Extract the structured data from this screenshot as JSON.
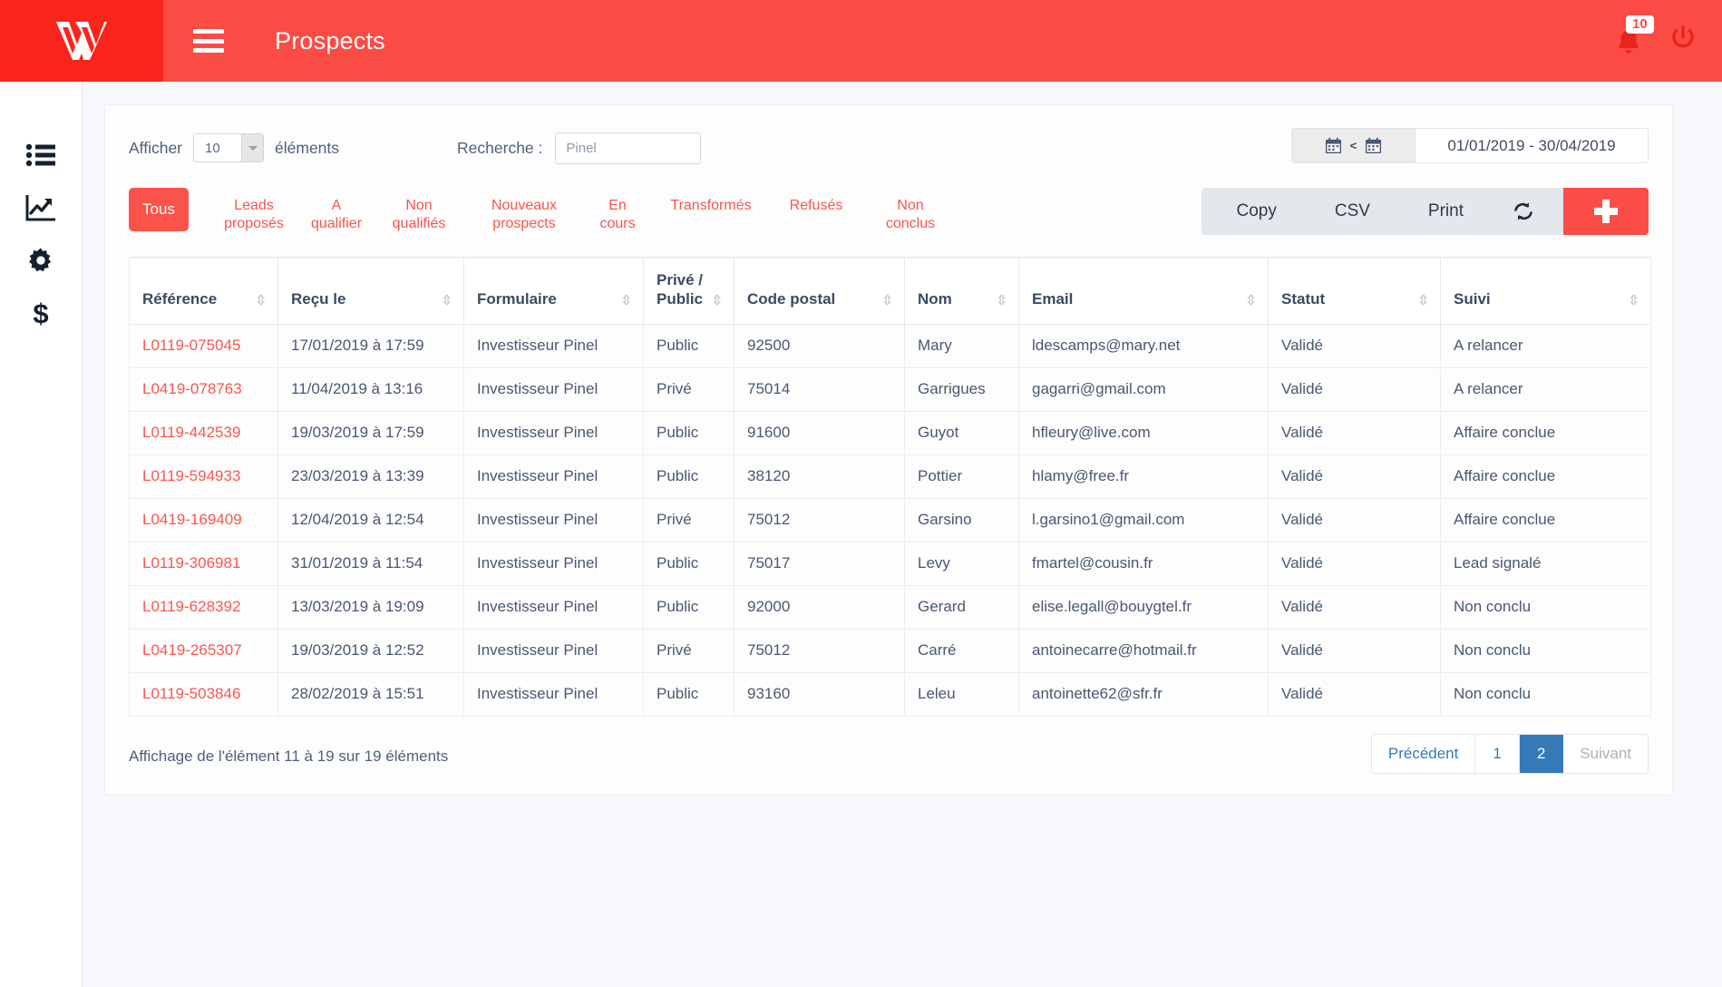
{
  "header": {
    "title": "Prospects",
    "logo_icon": "vwg-logo-icon",
    "menu_icon": "hamburger-menu-icon",
    "notification_icon": "bell-icon",
    "notification_count": "10",
    "power_icon": "power-icon"
  },
  "sidebar": {
    "items": [
      {
        "icon": "list-icon",
        "name": "sidebar-item-list"
      },
      {
        "icon": "chart-line-icon",
        "name": "sidebar-item-statistics"
      },
      {
        "icon": "gear-icon",
        "name": "sidebar-item-settings"
      },
      {
        "icon": "dollar-icon",
        "name": "sidebar-item-billing"
      }
    ]
  },
  "toolbar": {
    "show_label": "Afficher",
    "length_value": "10",
    "elements_label": "éléments",
    "search_label": "Recherche :",
    "search_value": "Pinel",
    "search_placeholder": "Pinel",
    "date_range": "01/01/2019 - 30/04/2019",
    "calendar_icon": "calendar-icon",
    "range_separator": "<"
  },
  "tabs": [
    {
      "label": "Tous",
      "active": true
    },
    {
      "label": "Leads\nproposés",
      "active": false
    },
    {
      "label": "A\nqualifier",
      "active": false
    },
    {
      "label": "Non\nqualifiés",
      "active": false
    },
    {
      "label": "Nouveaux\nprospects",
      "active": false
    },
    {
      "label": "En\ncours",
      "active": false
    },
    {
      "label": "Transformés",
      "active": false
    },
    {
      "label": "Refusés",
      "active": false
    },
    {
      "label": "Non\nconclus",
      "active": false
    }
  ],
  "export": {
    "copy_label": "Copy",
    "csv_label": "CSV",
    "print_label": "Print",
    "refresh_icon": "refresh-icon",
    "add_icon": "plus-icon"
  },
  "table": {
    "columns": [
      "Référence",
      "Reçu le",
      "Formulaire",
      "Privé /\nPublic",
      "Code postal",
      "Nom",
      "Email",
      "Statut",
      "Suivi"
    ],
    "sort_icon": "sort-arrows-icon",
    "rows": [
      {
        "reference": "L0119-075045",
        "received": "17/01/2019 à 17:59",
        "form": "Investisseur Pinel",
        "visibility": "Public",
        "postal_code": "92500",
        "name": "Mary",
        "email": "ldescamps@mary.net",
        "status": "Validé",
        "followup": "A relancer"
      },
      {
        "reference": "L0419-078763",
        "received": "11/04/2019 à 13:16",
        "form": "Investisseur Pinel",
        "visibility": "Privé",
        "postal_code": "75014",
        "name": "Garrigues",
        "email": "gagarri@gmail.com",
        "status": "Validé",
        "followup": "A relancer"
      },
      {
        "reference": "L0119-442539",
        "received": "19/03/2019 à 17:59",
        "form": "Investisseur Pinel",
        "visibility": "Public",
        "postal_code": "91600",
        "name": "Guyot",
        "email": "hfleury@live.com",
        "status": "Validé",
        "followup": "Affaire conclue"
      },
      {
        "reference": "L0119-594933",
        "received": "23/03/2019 à 13:39",
        "form": "Investisseur Pinel",
        "visibility": "Public",
        "postal_code": "38120",
        "name": "Pottier",
        "email": "hlamy@free.fr",
        "status": "Validé",
        "followup": "Affaire conclue"
      },
      {
        "reference": "L0419-169409",
        "received": "12/04/2019 à 12:54",
        "form": "Investisseur Pinel",
        "visibility": "Privé",
        "postal_code": "75012",
        "name": "Garsino",
        "email": "l.garsino1@gmail.com",
        "status": "Validé",
        "followup": "Affaire conclue"
      },
      {
        "reference": "L0119-306981",
        "received": "31/01/2019 à 11:54",
        "form": "Investisseur Pinel",
        "visibility": "Public",
        "postal_code": "75017",
        "name": "Levy",
        "email": "fmartel@cousin.fr",
        "status": "Validé",
        "followup": "Lead signalé"
      },
      {
        "reference": "L0119-628392",
        "received": "13/03/2019 à 19:09",
        "form": "Investisseur Pinel",
        "visibility": "Public",
        "postal_code": "92000",
        "name": "Gerard",
        "email": "elise.legall@bouygtel.fr",
        "status": "Validé",
        "followup": "Non conclu"
      },
      {
        "reference": "L0419-265307",
        "received": "19/03/2019 à 12:52",
        "form": "Investisseur Pinel",
        "visibility": "Privé",
        "postal_code": "75012",
        "name": "Carré",
        "email": "antoinecarre@hotmail.fr",
        "status": "Validé",
        "followup": "Non conclu"
      },
      {
        "reference": "L0119-503846",
        "received": "28/02/2019 à 15:51",
        "form": "Investisseur Pinel",
        "visibility": "Public",
        "postal_code": "93160",
        "name": "Leleu",
        "email": "antoinette62@sfr.fr",
        "status": "Validé",
        "followup": "Non conclu"
      }
    ]
  },
  "footer": {
    "info": "Affichage de l'élément 11 à 19 sur 19 éléments",
    "pagination": {
      "previous": "Précédent",
      "pages": [
        "1",
        "2"
      ],
      "active_page": "2",
      "next": "Suivant"
    }
  },
  "colors": {
    "brand_dark": "#fa241c",
    "brand": "#fb4b45",
    "accent_red": "#fb534c",
    "page_bg": "#f7f8fc",
    "pager_active": "#337ab7"
  }
}
